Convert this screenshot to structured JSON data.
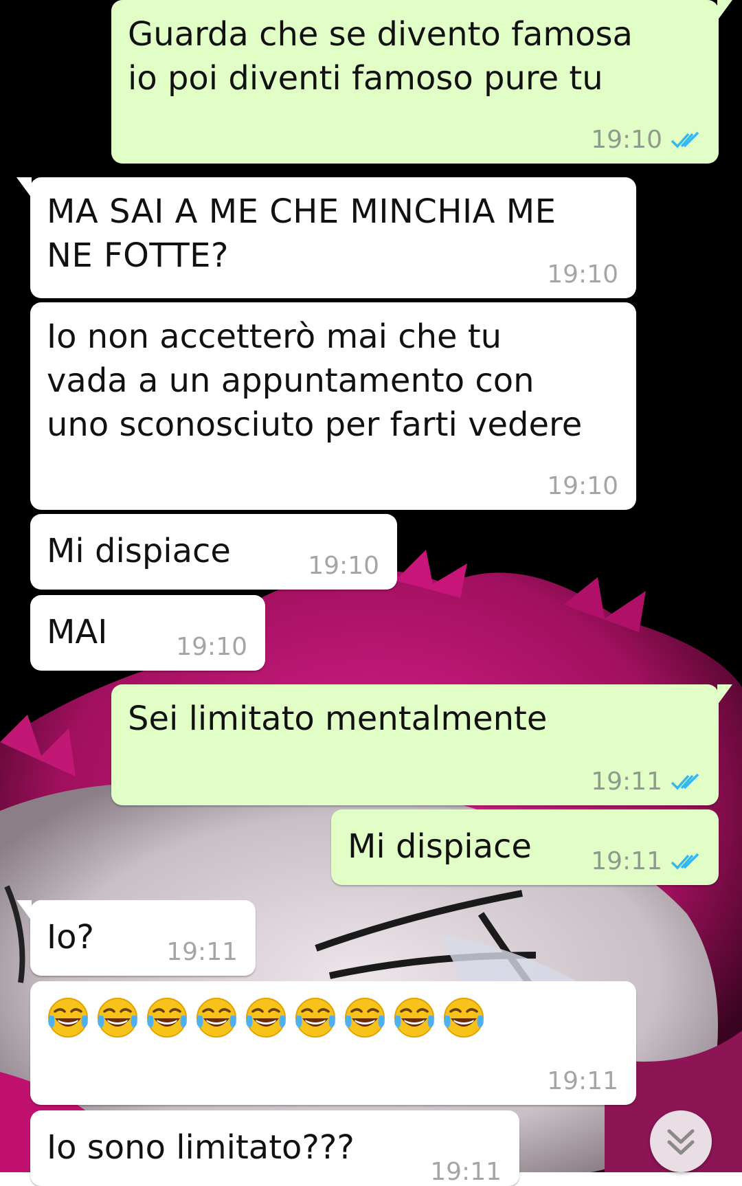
{
  "chat": {
    "messages": [
      {
        "direction": "outgoing",
        "text": "Guarda che se divento famosa\nio poi diventi famoso pure tu",
        "time": "19:10",
        "read": true
      },
      {
        "direction": "incoming",
        "text": "MA SAI A ME CHE MINCHIA ME\nNE FOTTE?",
        "time": "19:10"
      },
      {
        "direction": "incoming",
        "text": "Io non accetterò mai che tu\nvada a un appuntamento con\nuno sconosciuto per farti vedere",
        "time": "19:10"
      },
      {
        "direction": "incoming",
        "text": "Mi dispiace",
        "time": "19:10"
      },
      {
        "direction": "incoming",
        "text": "MAI",
        "time": "19:10"
      },
      {
        "direction": "outgoing",
        "text": "Sei limitato mentalmente",
        "time": "19:11",
        "read": true
      },
      {
        "direction": "outgoing",
        "text": "Mi dispiace",
        "time": "19:11",
        "read": true
      },
      {
        "direction": "incoming",
        "text": "Io?",
        "time": "19:11"
      },
      {
        "direction": "incoming",
        "emoji": "face-with-tears-of-joy",
        "emoji_count": 9,
        "time": "19:11"
      },
      {
        "direction": "incoming",
        "text": "Io sono limitato???",
        "time": "19:11"
      }
    ]
  },
  "colors": {
    "outgoing_bubble": "#e1fec6",
    "incoming_bubble": "#ffffff",
    "read_ticks": "#34b7f1",
    "timestamp": "#8e9a8c"
  },
  "icons": {
    "read_receipt": "double-check-icon",
    "scroll_down": "chevron-down-icon",
    "emoji": "face-with-tears-of-joy-icon"
  }
}
